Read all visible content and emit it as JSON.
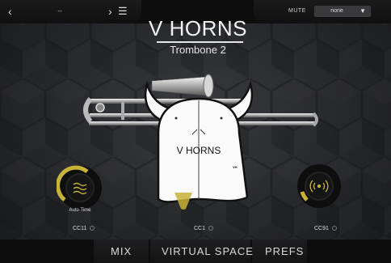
{
  "topbar": {
    "prev_icon": "chevron-left-icon",
    "preset_value": "--",
    "next_icon": "chevron-right-icon",
    "menu_icon": "hamburger-menu-icon",
    "mute_label": "MUTE",
    "mute_value": "none"
  },
  "header": {
    "title": "V HORNS",
    "subtitle": "Trombone 2"
  },
  "logo": {
    "text": "V HORNS",
    "mark": "VH"
  },
  "knobs": {
    "left_label": "Auto Time",
    "left_cc": "CC11",
    "center_cc": "CC1",
    "right_cc": "CC91",
    "left_icon": "wave-icon",
    "right_icon": "reverb-icon"
  },
  "tabs": [
    "MIX",
    "VIRTUAL SPACE",
    "PREFS"
  ],
  "colors": {
    "accent": "#c8b238",
    "background": "#2a2b2e"
  }
}
